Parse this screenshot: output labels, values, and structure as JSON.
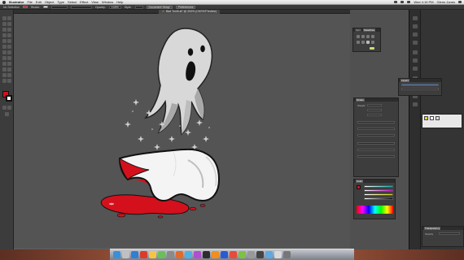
{
  "menubar": {
    "app_name": "Illustrator",
    "menus": [
      "File",
      "Edit",
      "Object",
      "Type",
      "Select",
      "Effect",
      "View",
      "Window",
      "Help"
    ],
    "clock": "Wed 4:19 PM",
    "user": "Glenn Jones"
  },
  "controlbar": {
    "selection_label": "No Selection",
    "stroke_label": "Stroke:",
    "opacity_label": "Opacity:",
    "opacity_value": "100%",
    "style_label": "Style:",
    "doc_setup_button": "Document Setup",
    "preferences_button": "Preferences"
  },
  "document": {
    "tab_title": "Bad Tooth.ai* @ 200% (CMYK/Preview)"
  },
  "tools": {
    "fill_color": "#d4101c",
    "stroke_color": "#ffffff"
  },
  "panels": {
    "brushes": {
      "tabs": [
        "Sym",
        "Swatches"
      ]
    },
    "layers": {
      "title": "Layers"
    },
    "stroke": {
      "title": "Stroke",
      "weight_label": "Weight:"
    },
    "color": {
      "title": "Color"
    },
    "right_bottom": {
      "title": "Transparency"
    },
    "far_right_bottom": {
      "label": "Opacity"
    }
  },
  "colors": {
    "ui_bg": "#3c3c3c",
    "canvas_bg": "#545454",
    "blood_red": "#d4101c"
  }
}
